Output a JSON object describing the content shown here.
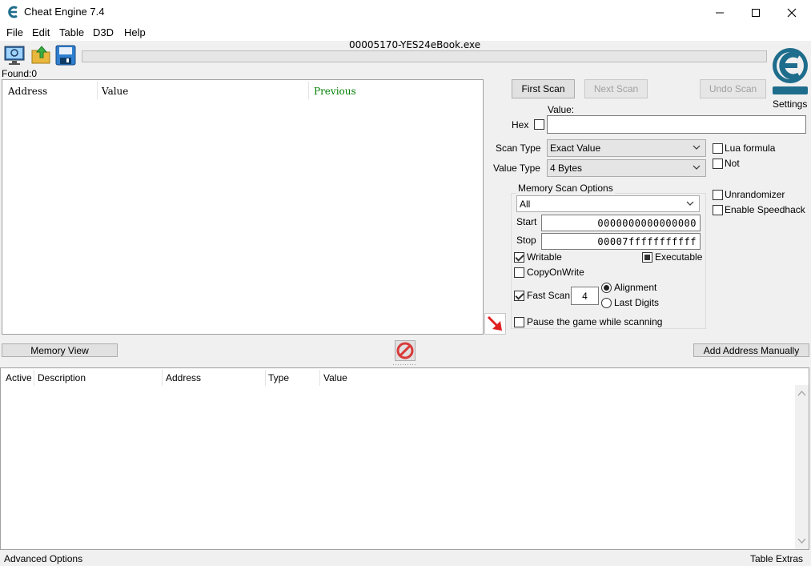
{
  "window": {
    "title": "Cheat Engine 7.4",
    "minimize_icon": "minimize-icon",
    "maximize_icon": "maximize-icon",
    "close_icon": "close-icon"
  },
  "menu": [
    "File",
    "Edit",
    "Table",
    "D3D",
    "Help"
  ],
  "toolbar": {
    "process_name": "00005170-YES24eBook.exe",
    "icons": [
      "open-process-icon",
      "open-file-icon",
      "save-icon"
    ]
  },
  "found_label": "Found:0",
  "settings_label": "Settings",
  "logo_text": "Cheat Engine",
  "results": {
    "columns": [
      "Address",
      "Value",
      "Previous"
    ]
  },
  "scan": {
    "first_scan": "First Scan",
    "next_scan": "Next Scan",
    "undo_scan": "Undo Scan",
    "value_label": "Value:",
    "hex_label": "Hex",
    "value": "",
    "scan_type_label": "Scan Type",
    "scan_type": "Exact Value",
    "value_type_label": "Value Type",
    "value_type": "4 Bytes",
    "lua_formula": "Lua formula",
    "not_label": "Not",
    "unrandomizer": "Unrandomizer",
    "enable_speedhack": "Enable Speedhack"
  },
  "memory_scan_options": {
    "title": "Memory Scan Options",
    "region": "All",
    "start_label": "Start",
    "start": "0000000000000000",
    "stop_label": "Stop",
    "stop": "00007fffffffffff",
    "writable": "Writable",
    "executable": "Executable",
    "copy_on_write": "CopyOnWrite",
    "fast_scan": "Fast Scan",
    "fast_scan_value": "4",
    "alignment": "Alignment",
    "last_digits": "Last Digits",
    "pause_game": "Pause the game while scanning"
  },
  "buttons": {
    "memory_view": "Memory View",
    "add_address_manually": "Add Address Manually"
  },
  "address_list": {
    "columns": [
      "Active",
      "Description",
      "Address",
      "Type",
      "Value"
    ]
  },
  "footer": {
    "advanced_options": "Advanced Options",
    "table_extras": "Table Extras"
  },
  "colors": {
    "previous_header": "#008000",
    "arrow": "#e02020",
    "stop_icon": "#d93a3a",
    "logo": "#1f6d8c"
  }
}
